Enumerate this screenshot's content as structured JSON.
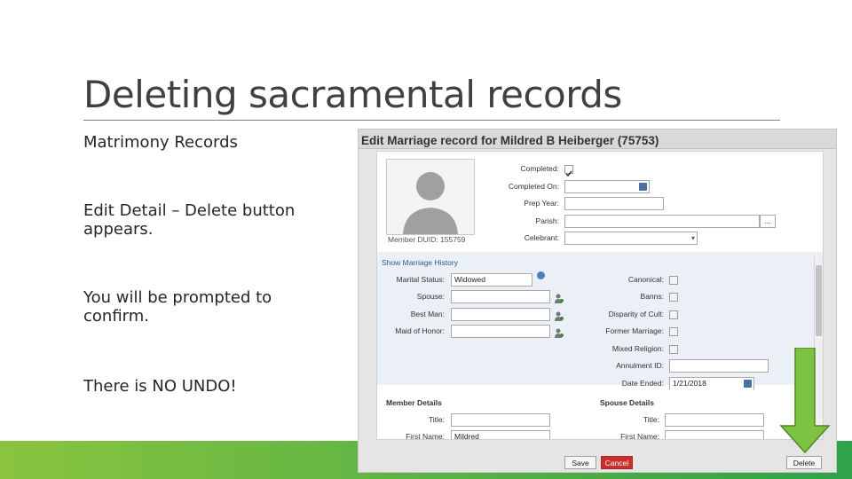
{
  "slide": {
    "title": "Deleting sacramental records",
    "bullets": [
      "Matrimony Records",
      "Edit Detail – Delete button appears.",
      "You will be prompted to confirm.",
      "There is NO UNDO!"
    ],
    "colors": {
      "green_start": "#8ac43f",
      "green_end": "#2ea24a",
      "arrow": "#7dc242"
    }
  },
  "dialog": {
    "title": "Edit Marriage record for Mildred B Heiberger (75753)",
    "member_duid": "Member DUID: 155759",
    "fields_top": {
      "completed": "Completed:",
      "completed_on": "Completed On:",
      "prep_year": "Prep Year:",
      "parish": "Parish:",
      "celebrant": "Celebrant:"
    },
    "show_history": "Show Marriage History",
    "marital_status_label": "Marital Status:",
    "marital_status_value": "Widowed",
    "spouse": "Spouse:",
    "best_man": "Best Man:",
    "maid_of_honor": "Maid of Honor:",
    "right_fields": {
      "canonical": "Canonical:",
      "banns": "Banns:",
      "disparity": "Disparity of Cult:",
      "former": "Former Marriage:",
      "mixed": "Mixed Religion:",
      "annulment": "Annulment ID:",
      "date_ended": "Date Ended:",
      "date_ended_value": "1/21/2018"
    },
    "member_details": "Member Details",
    "spouse_details": "Spouse Details",
    "title_label": "Title:",
    "first_name_label": "First Name:",
    "first_name_value": "Mildred",
    "parish_btn": "...",
    "buttons": {
      "save": "Save",
      "cancel": "Cancel",
      "delete": "Delete"
    }
  }
}
